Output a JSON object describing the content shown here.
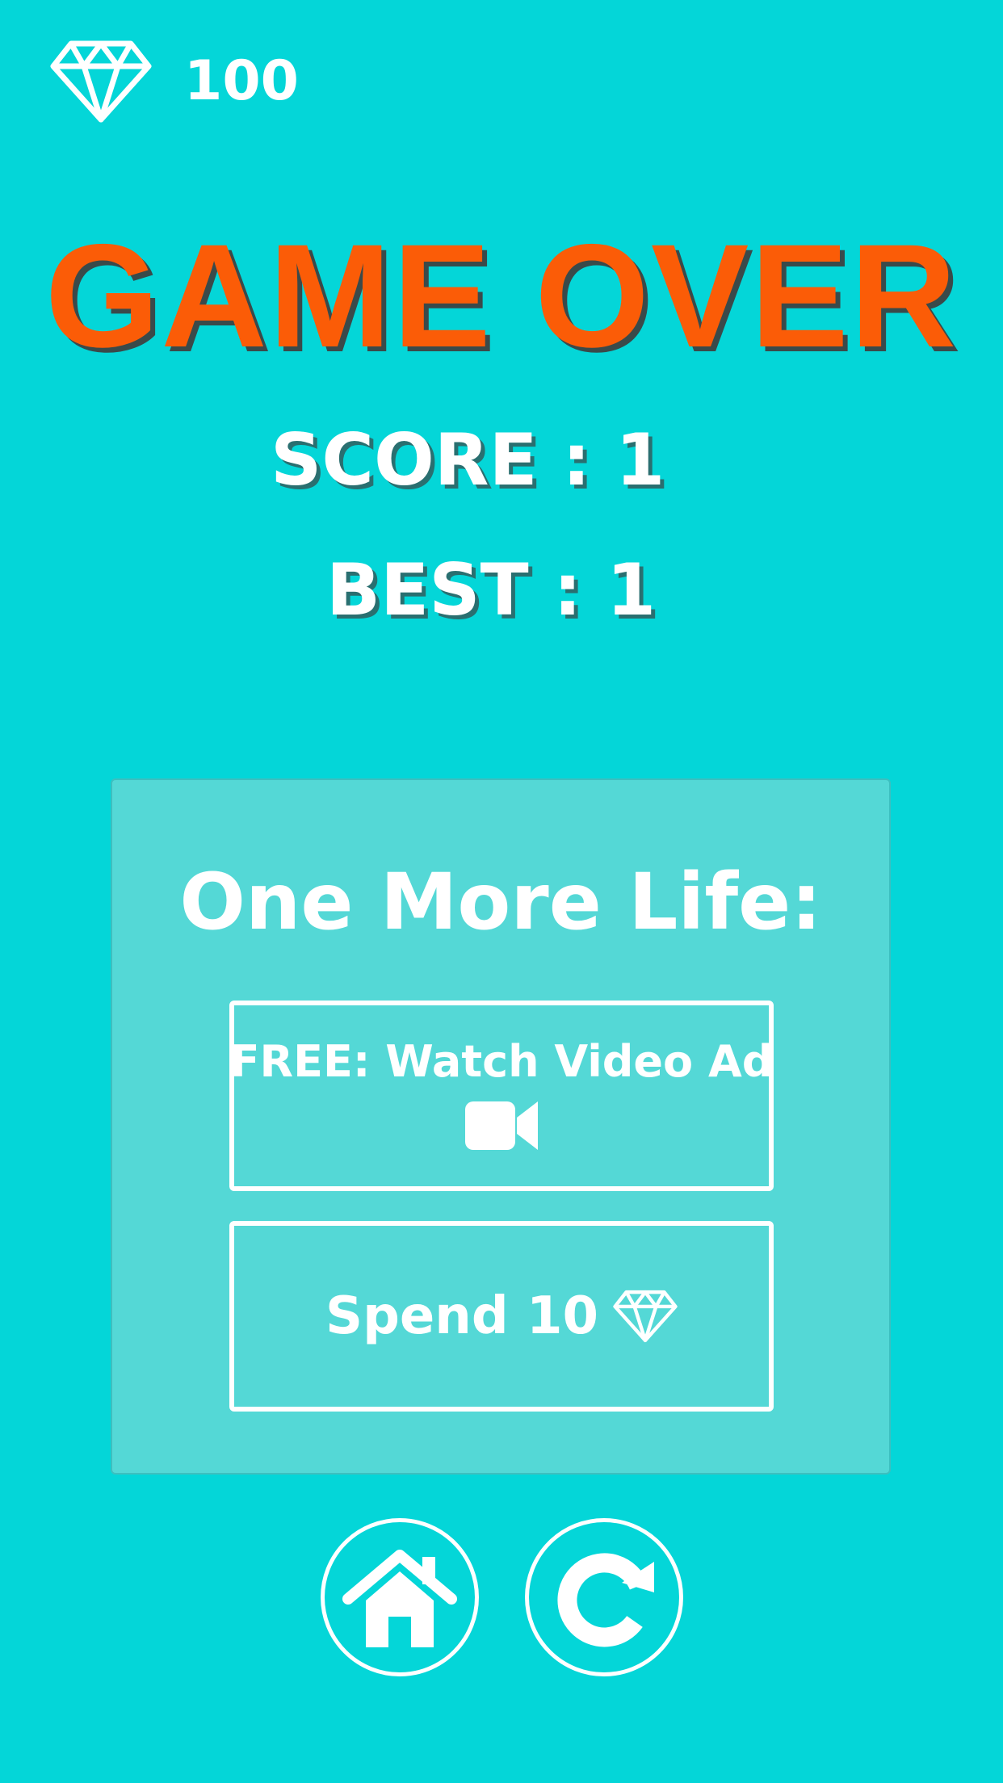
{
  "hud": {
    "gem_count": "100",
    "gem_icon": "diamond-icon"
  },
  "title": "GAME OVER",
  "stats": {
    "score": "SCORE : 1",
    "best": "BEST : 1"
  },
  "life_panel": {
    "title": "One More Life:",
    "video_button": {
      "label": "FREE: Watch Video Ad",
      "icon": "video-camera-icon"
    },
    "spend_button": {
      "label": "Spend 10",
      "icon": "diamond-icon"
    }
  },
  "nav": {
    "home_icon": "home-icon",
    "restart_icon": "restart-icon"
  },
  "colors": {
    "background": "#04d6d8",
    "title": "#fb5c07",
    "panel": "#54d8d6",
    "text": "#ffffff"
  }
}
